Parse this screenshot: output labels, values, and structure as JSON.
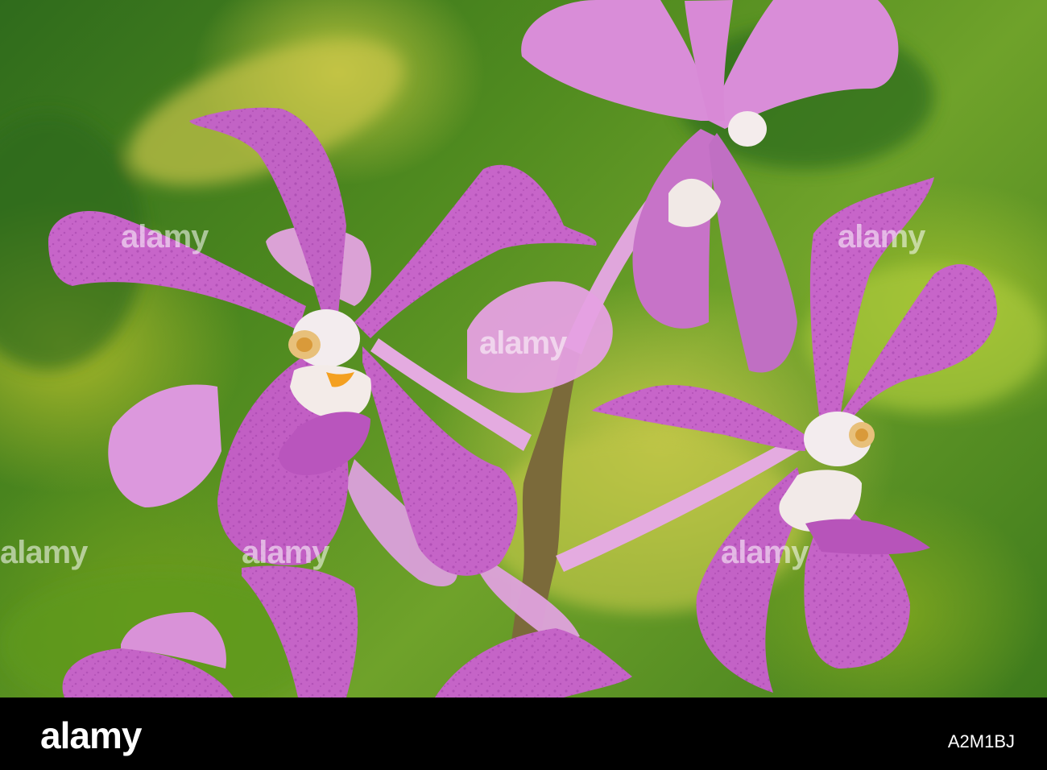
{
  "image": {
    "subject": "pink-orchid-flowers",
    "colors": {
      "petal": "#c765c9",
      "petal_light": "#e6a3e3",
      "petal_spot": "#a03fa8",
      "stem": "#7b6a3a",
      "background_green": "#4f8a1f"
    }
  },
  "watermark": {
    "text": "alamy"
  },
  "footer": {
    "logo": "alamy",
    "image_id": "A2M1BJ"
  }
}
